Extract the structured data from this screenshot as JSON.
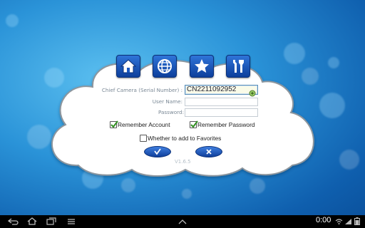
{
  "form": {
    "camera_label": "Chief Camera (Serial Number) :",
    "camera_value": "CN2211092952",
    "username_label": "User Name:",
    "username_value": "",
    "password_label": "Password:",
    "password_value": "",
    "remember_account_label": "Remember Account",
    "remember_account_checked": true,
    "remember_password_label": "Remember Password",
    "remember_password_checked": true,
    "favorites_label": "Whether to add to Favorites",
    "favorites_checked": false
  },
  "version": "V1.6.5",
  "top_icons": [
    "home-icon",
    "globe-icon",
    "star-icon",
    "tools-icon"
  ],
  "status": {
    "time": "0:00"
  },
  "colors": {
    "accent": "#1a58c0",
    "background": "#2a93d8"
  }
}
